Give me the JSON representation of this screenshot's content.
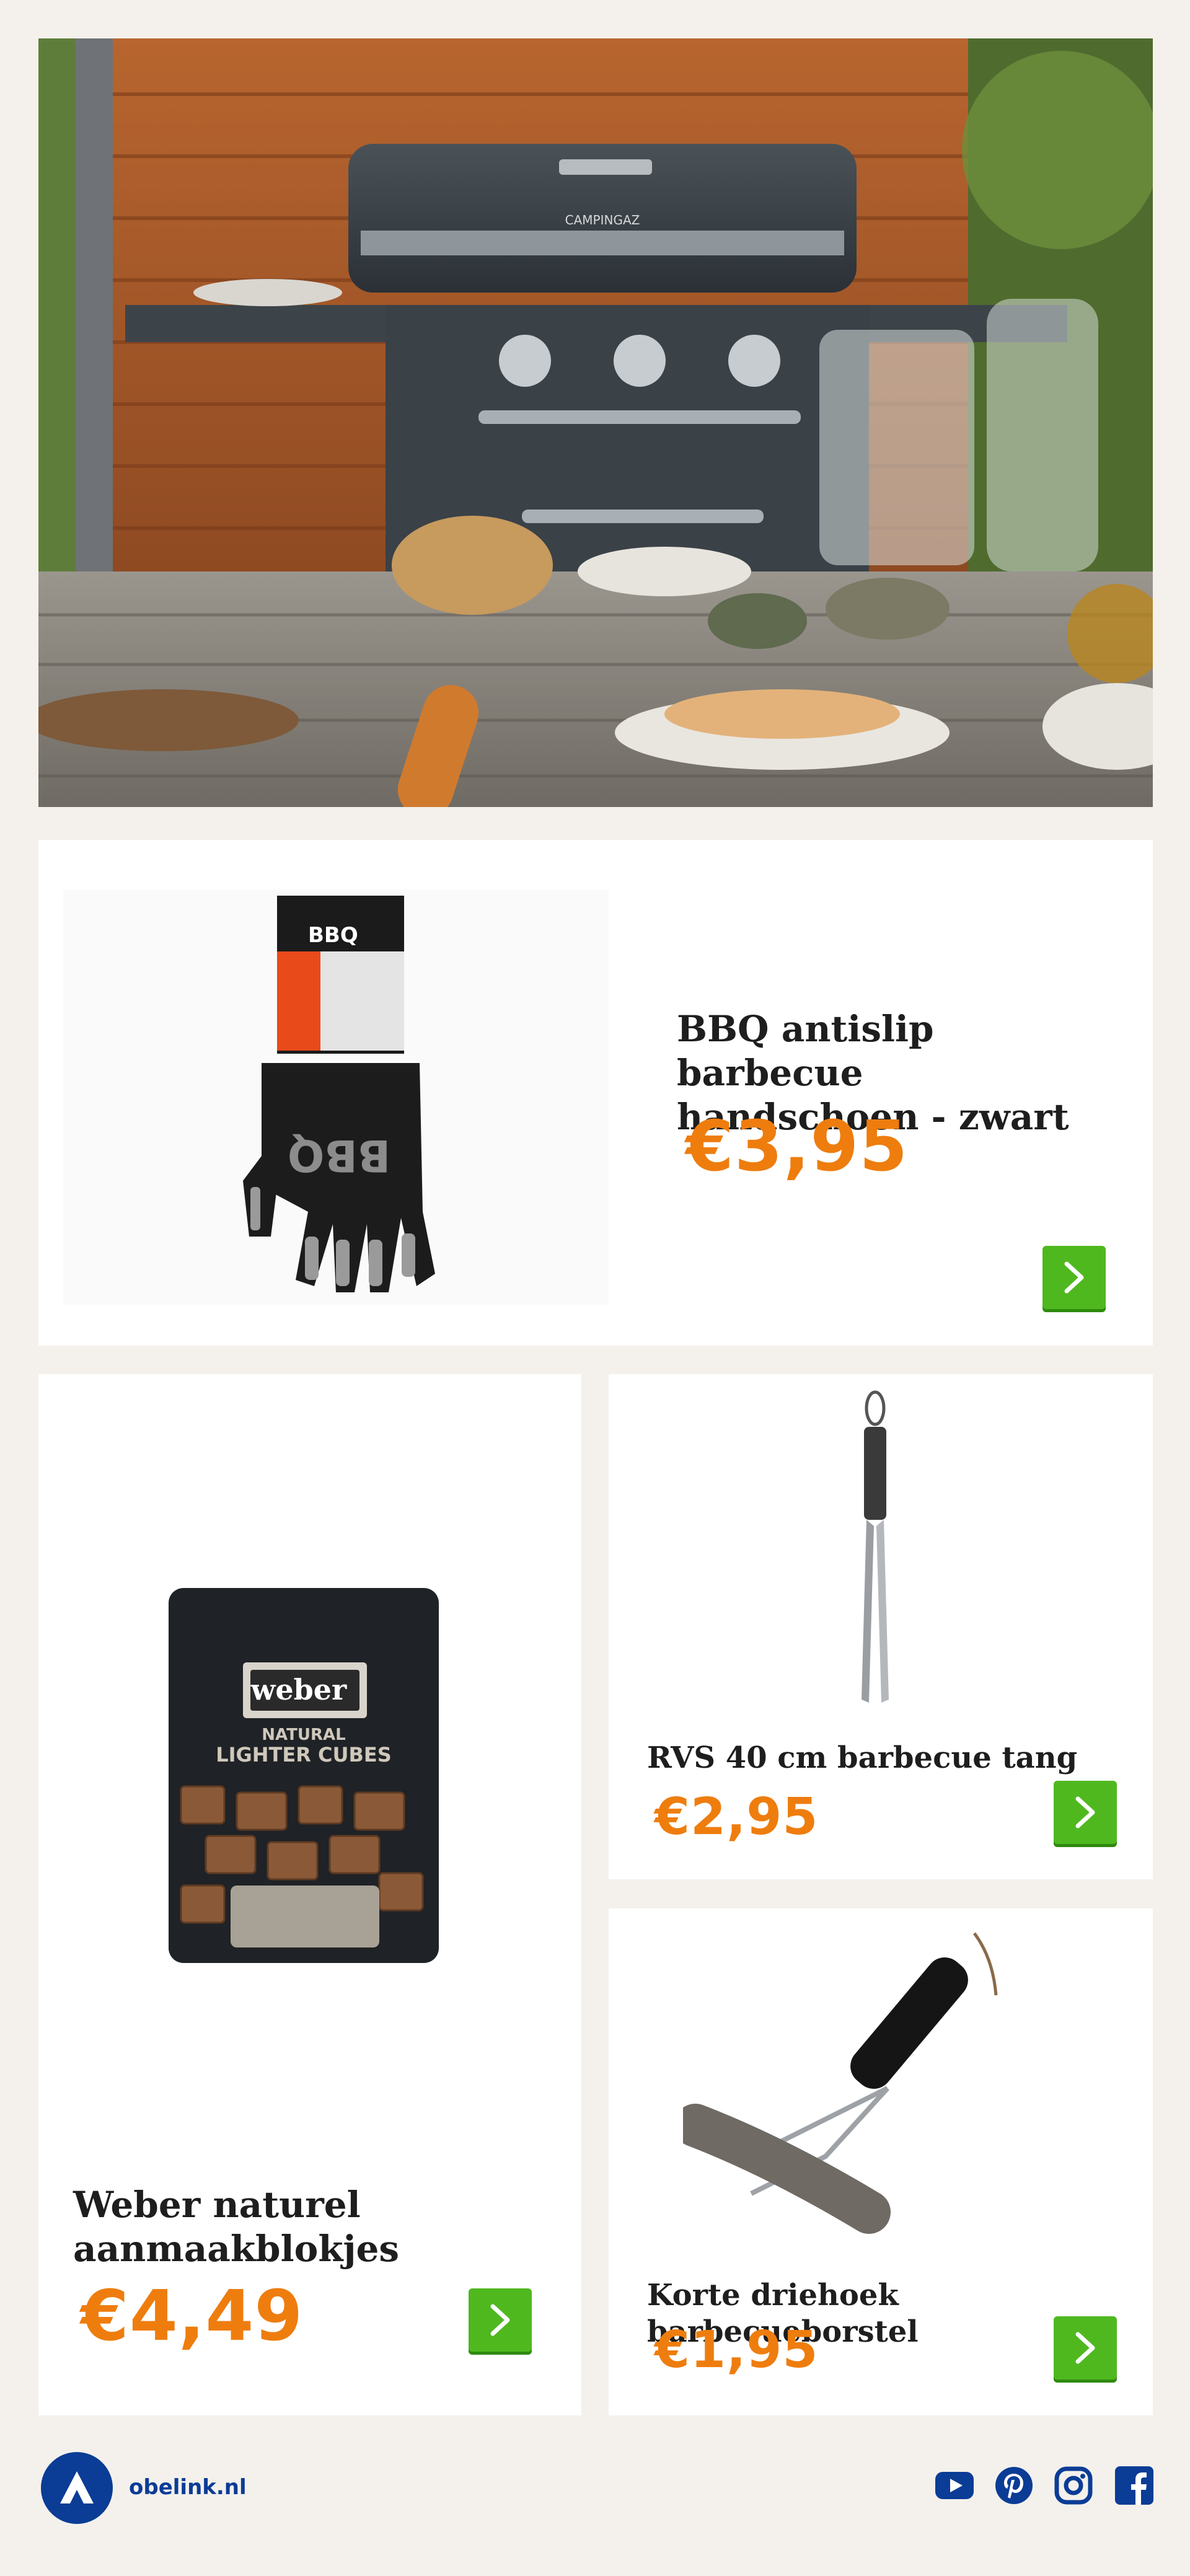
{
  "hero": {
    "brand_on_grill": "CAMPINGAZ"
  },
  "products": [
    {
      "title_line1": "BBQ antislip barbecue",
      "title_line2": "handschoen - zwart",
      "price": "€3,95",
      "image": "bbq-glove",
      "package_text": "BBQ"
    },
    {
      "title_line1": "Weber naturel",
      "title_line2": "aanmaakblokjes",
      "price": "€4,49",
      "image": "weber-lighter-cubes",
      "package_brand": "weber",
      "package_line1": "NATURAL",
      "package_line2": "LIGHTER CUBES"
    },
    {
      "title_line1": "RVS 40 cm barbecue tang",
      "price": "€2,95",
      "image": "bbq-tongs"
    },
    {
      "title_line1": "Korte driehoek barbecueborstel",
      "price": "€1,95",
      "image": "bbq-brush"
    }
  ],
  "footer": {
    "site": "obelink.nl",
    "logo_icon": "obelink-tent-logo",
    "social_icons": [
      "youtube-icon",
      "pinterest-icon",
      "instagram-icon",
      "facebook-icon"
    ]
  },
  "colors": {
    "price": "#ee7d0e",
    "button": "#4fb81f",
    "brand_blue": "#0b3c96",
    "background": "#f4f1ec"
  }
}
